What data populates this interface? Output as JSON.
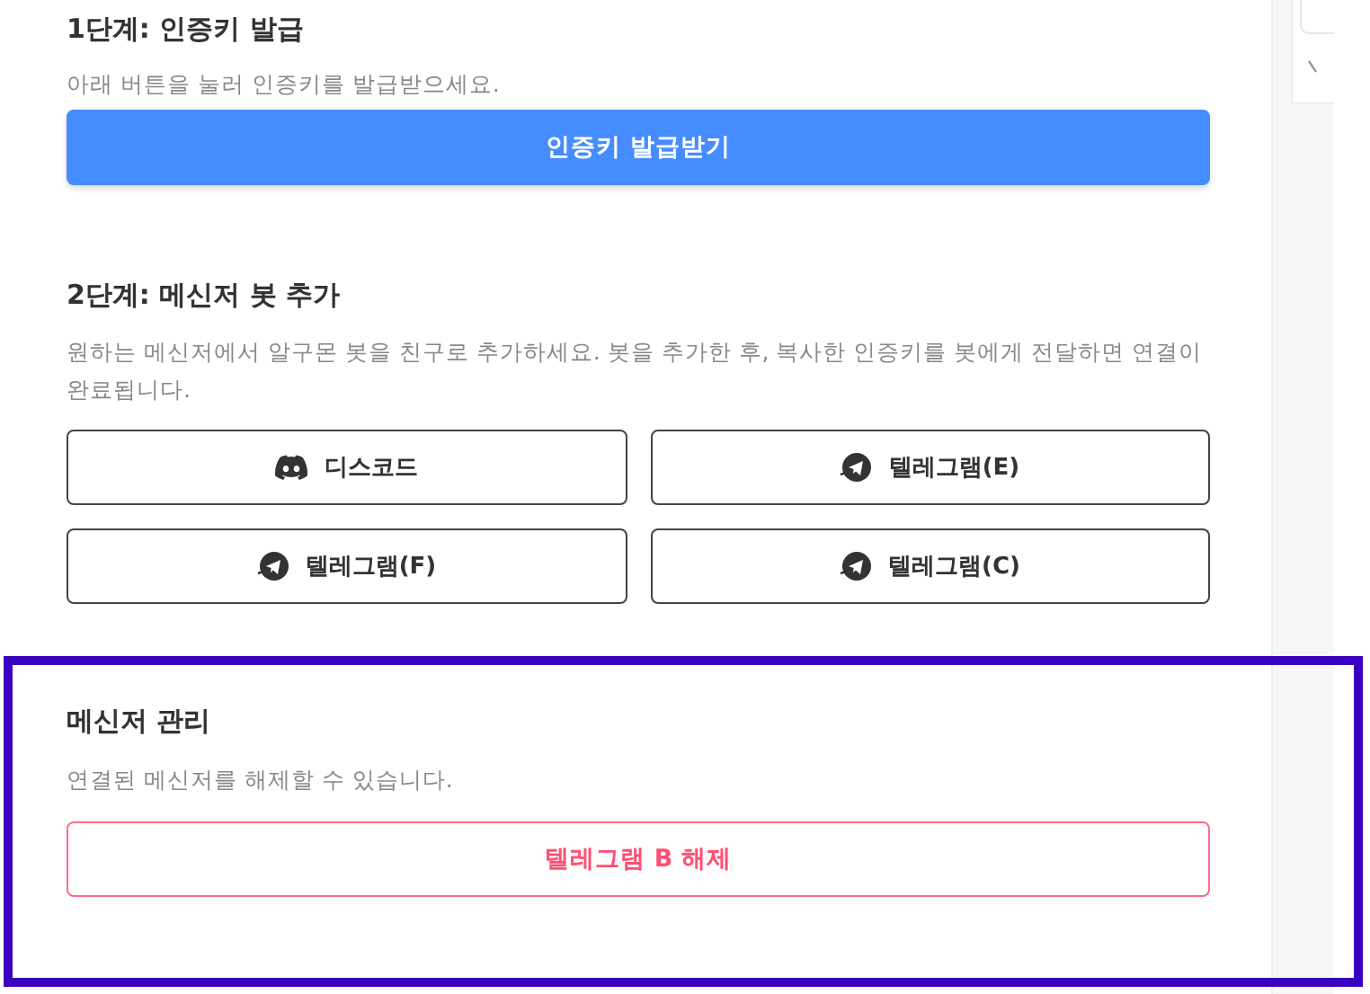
{
  "steps": [
    {
      "kind": "issue",
      "title": "1단계: 인증키 발급",
      "description": "아래 버튼을 눌러 인증키를 발급받으세요.",
      "button": "인증키 발급받기"
    },
    {
      "kind": "messengers",
      "title": "2단계: 메신저 봇 추가",
      "description": "원하는 메신저에서 알구몬 봇을 친구로 추가하세요. 봇을 추가한 후, 복사한 인증키를 봇에게 전달하면 연결이 완료됩니다.",
      "buttons": [
        {
          "kind": "discord",
          "label": "디스코드"
        },
        {
          "kind": "telegram",
          "label": "텔레그램(E)"
        },
        {
          "kind": "telegram",
          "label": "텔레그램(F)"
        },
        {
          "kind": "telegram",
          "label": "텔레그램(C)"
        }
      ]
    }
  ],
  "management": {
    "title": "메신저 관리",
    "description": "연결된 메신저를 해제할 수 있습니다.",
    "buttons": [
      "텔레그램 B 해제"
    ],
    "highlighted": true
  }
}
